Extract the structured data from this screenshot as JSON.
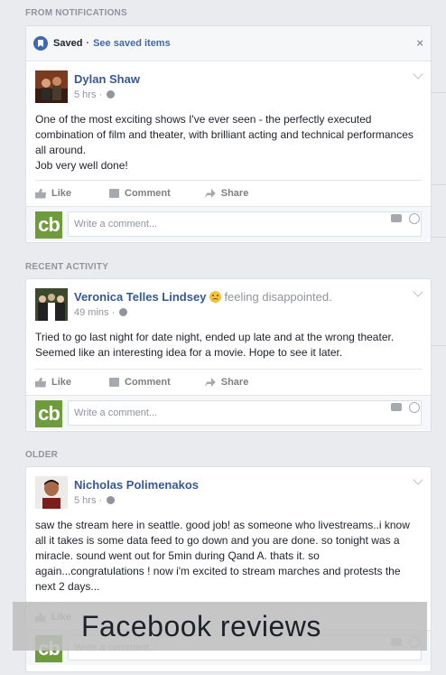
{
  "sections": {
    "notifications_label": "FROM NOTIFICATIONS",
    "recent_label": "RECENT ACTIVITY",
    "older_label": "OLDER"
  },
  "saved_bar": {
    "text": "Saved",
    "link": "See saved items",
    "close": "×"
  },
  "posts": [
    {
      "author": "Dylan Shaw",
      "time": "5 hrs",
      "text": "One of the most exciting shows I've ever seen - the perfectly executed combination of film and theater, with brilliant acting and technical performances all around.\nJob very well done!"
    },
    {
      "author": "Veronica Telles Lindsey",
      "feeling": "feeling disappointed.",
      "time": "49 mins",
      "text": "Tried to go last night for date night, ended up late and at the wrong theater. Seemed like an interesting idea for a movie. Hope to see it later."
    },
    {
      "author": "Nicholas Polimenakos",
      "time": "5 hrs",
      "text": "saw the stream here in seattle. good job! as someone who livestreams..i know all it takes is some data feed to go down and you are done. so tonight was a miracle. sound went out for 5min during Qand A. thats it. so again...congratulations ! now i'm excited to stream marches and protests the next 2 days..."
    }
  ],
  "actions": {
    "like": "Like",
    "comment": "Comment",
    "share": "Share"
  },
  "comment_box": {
    "placeholder": "Write a comment...",
    "logo": "cb"
  },
  "banner": "Facebook reviews",
  "icons": [
    "bookmark-icon",
    "close-icon",
    "globe-icon",
    "chevron-down-icon",
    "like-icon",
    "comment-icon",
    "share-icon",
    "camera-icon",
    "smiley-icon",
    "sad-emoji-icon"
  ],
  "colors": {
    "link": "#365899",
    "background": "#e9ebee",
    "logo_green": "#6e9b3c"
  }
}
